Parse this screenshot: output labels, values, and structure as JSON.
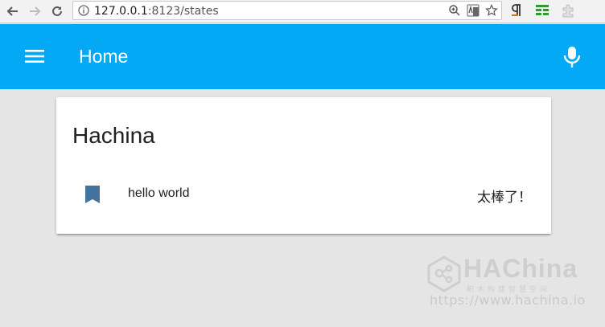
{
  "browser": {
    "url_host": "127.0.0.1",
    "url_rest": ":8123/states"
  },
  "header": {
    "title": "Home"
  },
  "card": {
    "title": "Hachina",
    "entities": [
      {
        "name": "hello world",
        "state": "太棒了！",
        "icon": "bookmark-icon"
      }
    ]
  },
  "watermark": {
    "brand": "HAChina",
    "tagline": "积木构建智慧空间",
    "url": "https://www.hachina.io"
  },
  "colors": {
    "header": "#03a9f4",
    "background": "#e5e5e5",
    "entity_icon": "#44739e"
  }
}
